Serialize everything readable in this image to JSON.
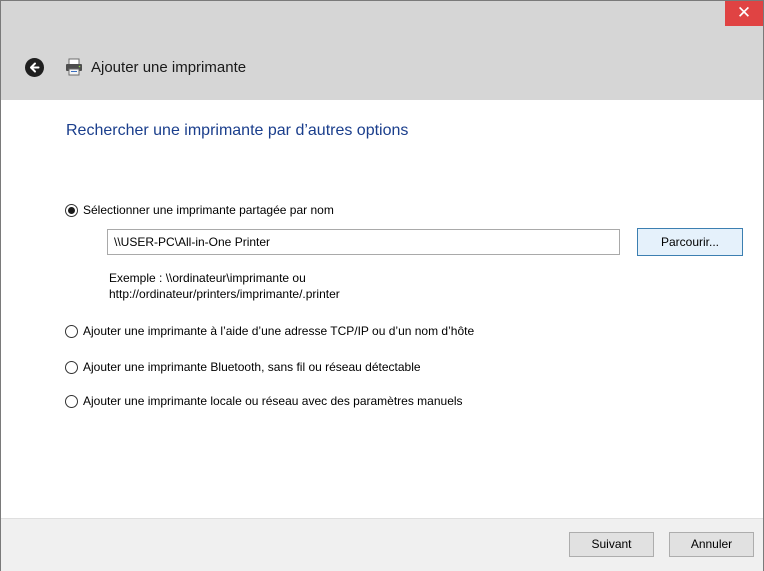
{
  "window": {
    "title": "Ajouter une imprimante",
    "close_label": "✕"
  },
  "content": {
    "heading": "Rechercher une imprimante par d’autres options",
    "options": [
      {
        "label": "Sélectionner une imprimante partagée par nom",
        "selected": true
      },
      {
        "label": "Ajouter une imprimante à l’aide d’une adresse TCP/IP ou d’un nom d’hôte",
        "selected": false
      },
      {
        "label": "Ajouter une imprimante Bluetooth, sans fil ou réseau détectable",
        "selected": false
      },
      {
        "label": "Ajouter une imprimante locale ou réseau avec des paramètres manuels",
        "selected": false
      }
    ],
    "share_path_value": "\\\\USER-PC\\All-in-One Printer",
    "browse_label": "Parcourir...",
    "example_line1": "Exemple : \\\\ordinateur\\imprimante ou",
    "example_line2": "http://ordinateur/printers/imprimante/.printer"
  },
  "footer": {
    "next_label": "Suivant",
    "cancel_label": "Annuler"
  }
}
